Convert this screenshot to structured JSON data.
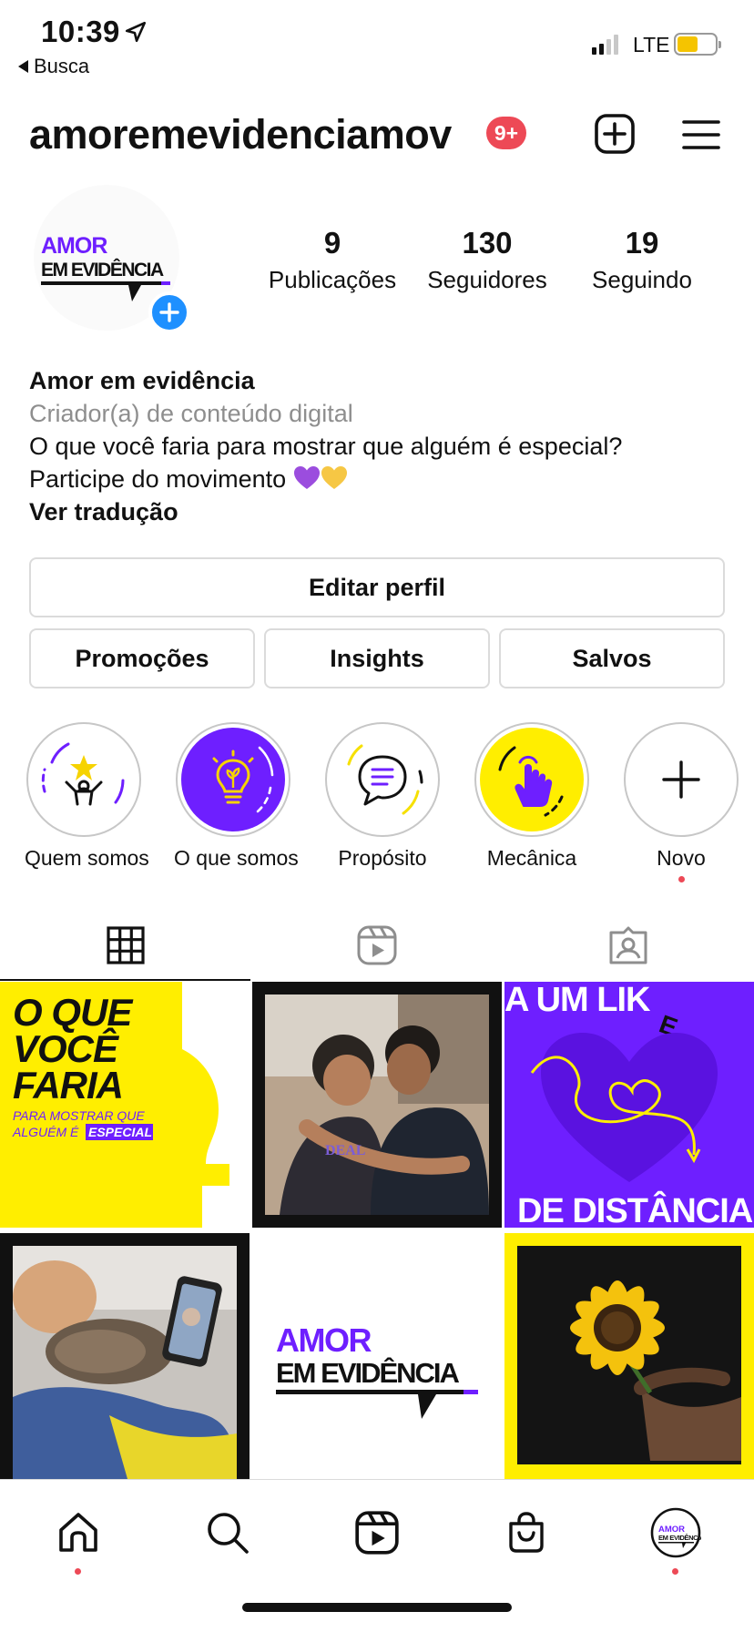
{
  "status_bar": {
    "time": "10:39",
    "back_label": "Busca",
    "network": "LTE",
    "battery_level": 0.55
  },
  "header": {
    "username": "amoremevidenciamov",
    "notification_badge": "9+"
  },
  "profile": {
    "avatar_logo": {
      "line1": "AMOR",
      "line2": "EM EVIDÊNCIA"
    },
    "stats": [
      {
        "value": "9",
        "label": "Publicações"
      },
      {
        "value": "130",
        "label": "Seguidores"
      },
      {
        "value": "19",
        "label": "Seguindo"
      }
    ],
    "bio": {
      "name": "Amor em evidência",
      "category": "Criador(a) de conteúdo digital",
      "line1": "O que você faria para mostrar que alguém é especial?",
      "line2": "Participe do movimento",
      "translate": "Ver tradução"
    }
  },
  "buttons": {
    "edit": "Editar perfil",
    "promotions": "Promoções",
    "insights": "Insights",
    "saved": "Salvos"
  },
  "highlights": [
    {
      "label": "Quem somos",
      "icon": "person-star-icon"
    },
    {
      "label": "O que somos",
      "icon": "lightbulb-icon"
    },
    {
      "label": "Propósito",
      "icon": "chat-bubble-icon"
    },
    {
      "label": "Mecânica",
      "icon": "tap-hand-icon"
    },
    {
      "label": "Novo",
      "icon": "plus-icon"
    }
  ],
  "tabs": [
    "grid-icon",
    "reels-icon",
    "tagged-icon"
  ],
  "posts": {
    "post1": {
      "line1": "O QUE",
      "line2": "VOCÊ",
      "line3": "FARIA",
      "small1": "PARA MOSTRAR QUE",
      "small2": "ALGUÉM É",
      "highlight": "ESPECIAL"
    },
    "post2": {
      "shirt": "DEAL"
    },
    "post3": {
      "top": "A UM LIK",
      "top_e": "E",
      "bottom": "DE DISTÂNCIA"
    },
    "post4": {},
    "post5": {
      "line1": "AMOR",
      "line2": "EM EVIDÊNCIA"
    },
    "post6": {}
  },
  "nav": [
    "home-icon",
    "search-icon",
    "reels-icon",
    "shop-icon",
    "profile-icon"
  ],
  "colors": {
    "purple": "#6e1fff",
    "yellow": "#ffee00",
    "badge_red": "#ed4956",
    "blue": "#1e90ff"
  }
}
